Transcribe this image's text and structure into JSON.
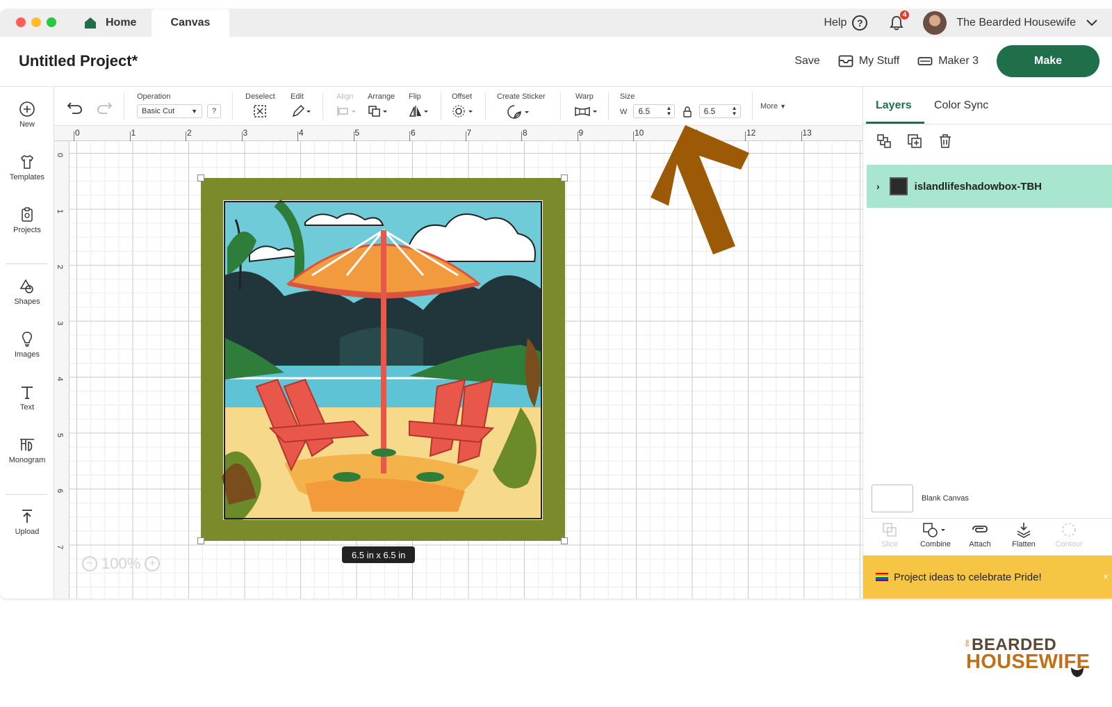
{
  "tabs": {
    "home": "Home",
    "canvas": "Canvas"
  },
  "topbar": {
    "help": "Help",
    "help_glyph": "?",
    "notification_count": "4",
    "user": "The Bearded Housewife"
  },
  "header": {
    "title": "Untitled Project*",
    "save": "Save",
    "my_stuff": "My Stuff",
    "machine": "Maker 3",
    "make": "Make"
  },
  "leftbar": {
    "items": [
      {
        "label": "New",
        "icon": "plus-circle-icon"
      },
      {
        "label": "Templates",
        "icon": "shirt-icon"
      },
      {
        "label": "Projects",
        "icon": "clipboard-icon"
      },
      {
        "label": "Shapes",
        "icon": "shapes-icon"
      },
      {
        "label": "Images",
        "icon": "lightbulb-icon"
      },
      {
        "label": "Text",
        "icon": "text-icon"
      },
      {
        "label": "Monogram",
        "icon": "monogram-icon"
      },
      {
        "label": "Upload",
        "icon": "upload-icon"
      }
    ]
  },
  "toolbar": {
    "operation_label": "Operation",
    "operation_value": "Basic Cut",
    "operation_help": "?",
    "deselect": "Deselect",
    "edit": "Edit",
    "align": "Align",
    "arrange": "Arrange",
    "flip": "Flip",
    "offset": "Offset",
    "create_sticker": "Create Sticker",
    "warp": "Warp",
    "size": "Size",
    "w_label": "W",
    "w_value": "6.5",
    "h_value": "6.5",
    "more": "More"
  },
  "rulers": {
    "top": [
      "0",
      "1",
      "2",
      "3",
      "4",
      "5",
      "6",
      "7",
      "8",
      "9",
      "10",
      "11",
      "12",
      "13"
    ],
    "left": [
      "0",
      "1",
      "2",
      "3",
      "4",
      "5",
      "6",
      "7"
    ]
  },
  "canvas": {
    "size_label": "6.5  in x 6.5  in",
    "zoom": "100%"
  },
  "rpanel": {
    "tab_layers": "Layers",
    "tab_color_sync": "Color Sync",
    "layer_name": "islandlifeshadowbox-TBH",
    "blank_canvas": "Blank Canvas",
    "actions": [
      "Slice",
      "Combine",
      "Attach",
      "Flatten",
      "Contour"
    ],
    "promo": "Project ideas to celebrate Pride!",
    "promo_close": "×"
  },
  "colors": {
    "accent": "#1e6f4a",
    "layer_highlight": "#a8e6cf",
    "promo_bg": "#f6c543",
    "arrow": "#9c5a06",
    "design_border": "#7b8a2a"
  },
  "logo": {
    "the": "the",
    "top": "BEARDED",
    "bottom": "HOUSEWIFE"
  }
}
